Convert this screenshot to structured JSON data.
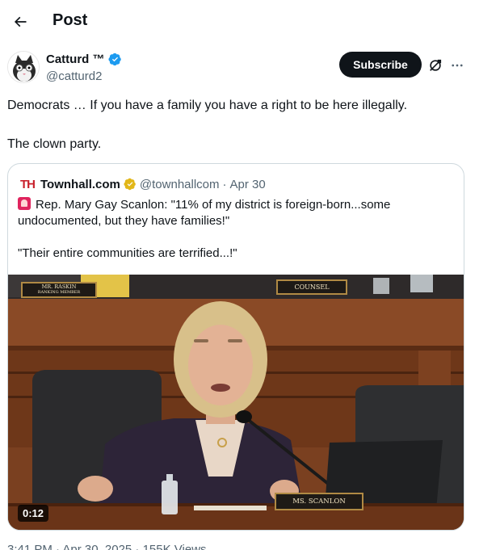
{
  "header": {
    "title": "Post"
  },
  "author": {
    "name": "Catturd ™",
    "handle": "@catturd2"
  },
  "actions": {
    "subscribe_label": "Subscribe"
  },
  "tweet": {
    "line1": "Democrats … If you have a family you have a right to be here illegally.",
    "line2": "The clown party."
  },
  "quote": {
    "logo_text": "TH",
    "name": "Townhall.com",
    "handle": "@townhallcom",
    "separator": "·",
    "date": "Apr 30",
    "text1": "Rep. Mary Gay Scanlon: \"11% of my district is foreign-born...some undocumented, but they have families!\"",
    "text2": "\"Their entire communities are terrified...!\""
  },
  "video": {
    "duration": "0:12",
    "sign_raskin_line1": "MR. RASKIN",
    "sign_raskin_line2": "RANKING MEMBER",
    "sign_counsel": "COUNSEL",
    "sign_scanlon": "MS. SCANLON"
  },
  "footer": {
    "meta": "3:41 PM · Apr 30, 2025 · 155K Views"
  },
  "colors": {
    "accent": "#1d9bf0",
    "gold_badge": "#e2b719",
    "text_primary": "#0f1419",
    "text_secondary": "#536471"
  },
  "icons": {
    "back": "arrow-left-icon",
    "verified": "verified-badge-icon",
    "grok": "grok-icon",
    "more": "more-icon",
    "gold": "gold-badge-icon"
  }
}
